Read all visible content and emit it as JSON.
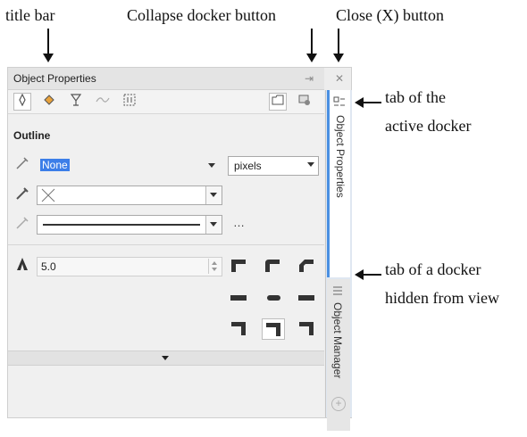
{
  "annotations": {
    "title_bar": "title bar",
    "collapse_docker_button": "Collapse docker button",
    "close_button": "Close (X) button",
    "active_tab_line1": "tab of the",
    "active_tab_line2": "active docker",
    "hidden_tab_line1": "tab of a docker",
    "hidden_tab_line2": "hidden from view"
  },
  "docker": {
    "title": "Object Properties",
    "collapse_glyph": "⇥",
    "close_glyph": "✕",
    "toolbar_icons": [
      "outline-pen-icon",
      "fill-bucket-icon",
      "transparency-glass-icon",
      "curve-icon",
      "frame-icon"
    ],
    "section": "Outline",
    "width_value": "None",
    "units_value": "pixels",
    "more_glyph": "…",
    "miter_value": "5.0"
  },
  "tabs": {
    "active_label": "Object Properties",
    "hidden_label": "Object Manager"
  },
  "colors": {
    "accent": "#4a90e2",
    "selection": "#3c7ee8"
  }
}
